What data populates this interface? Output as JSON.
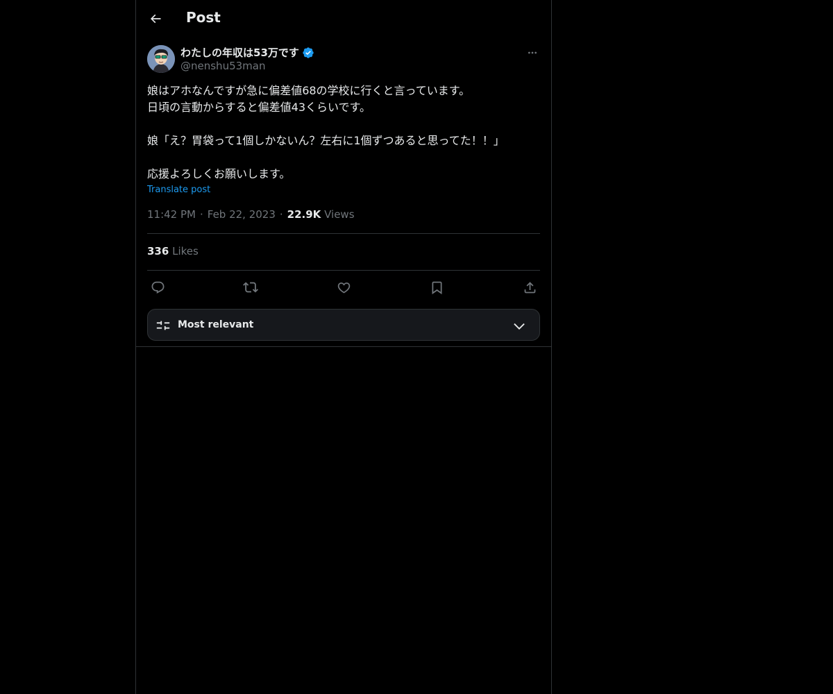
{
  "header": {
    "title": "Post"
  },
  "author": {
    "display_name": "わたしの年収は53万です",
    "handle": "@nenshu53man",
    "verified": true
  },
  "post": {
    "lines": [
      "娘はアホなんですが急に偏差値68の学校に行くと言っています。",
      "日頃の言動からすると偏差値43くらいです。",
      "",
      "娘「え？胃袋って1個しかないん？左右に1個ずつあると思ってた！！」",
      "",
      "応援よろしくお願いします。"
    ],
    "translate_label": "Translate post",
    "time": "11:42 PM",
    "date": "Feb 22, 2023",
    "views_count": "22.9K",
    "views_label": "Views",
    "separator": "·"
  },
  "engagement": {
    "likes_count": "336",
    "likes_label": "Likes"
  },
  "actions": [
    "reply-icon",
    "repost-icon",
    "like-icon",
    "bookmark-icon",
    "share-icon"
  ],
  "sort": {
    "label": "Most relevant"
  },
  "colors": {
    "background": "#000000",
    "text": "#e7e9ea",
    "muted": "#71767b",
    "link": "#1d9bf0",
    "border": "#2f3336"
  }
}
